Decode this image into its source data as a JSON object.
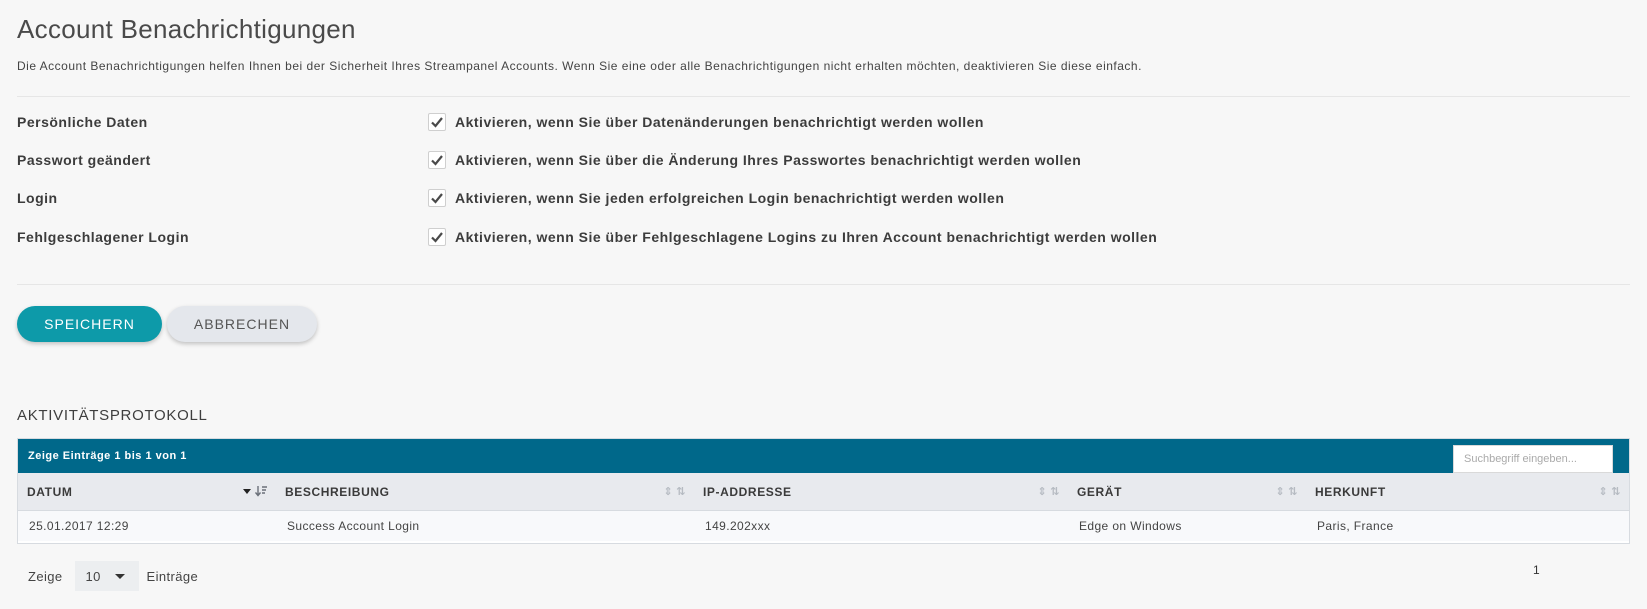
{
  "header": {
    "title": "Account Benachrichtigungen",
    "description": "Die Account Benachrichtigungen helfen Ihnen bei der Sicherheit Ihres Streampanel Accounts. Wenn Sie eine oder alle Benachrichtigungen nicht erhalten möchten, deaktivieren Sie diese einfach."
  },
  "settings": [
    {
      "label": "Persönliche Daten",
      "text": "Aktivieren, wenn Sie über Datenänderungen benachrichtigt werden wollen",
      "checked": true
    },
    {
      "label": "Passwort geändert",
      "text": "Aktivieren, wenn Sie über die Änderung Ihres Passwortes benachrichtigt werden wollen",
      "checked": true
    },
    {
      "label": "Login",
      "text": "Aktivieren, wenn Sie jeden erfolgreichen Login benachrichtigt werden wollen",
      "checked": true
    },
    {
      "label": "Fehlgeschlagener Login",
      "text": "Aktivieren, wenn Sie über Fehlgeschlagene Logins zu Ihren Account benachrichtigt werden wollen",
      "checked": true
    }
  ],
  "buttons": {
    "save": "SPEICHERN",
    "cancel": "ABBRECHEN"
  },
  "activity": {
    "title": "AKTIVITÄTSPROTOKOLL",
    "info": "Zeige Einträge 1 bis 1 von 1",
    "search_placeholder": "Suchbegriff eingeben...",
    "columns": [
      "DATUM",
      "BESCHREIBUNG",
      "IP-ADDRESSE",
      "GERÄT",
      "HERKUNFT"
    ],
    "rows": [
      [
        "25.01.2017 12:29",
        "Success Account Login",
        "149.202xxx",
        "Edge on Windows",
        "Paris, France"
      ]
    ],
    "length_prefix": "Zeige",
    "length_value": "10",
    "length_suffix": "Einträge",
    "current_page": "1"
  },
  "colors": {
    "accent": "#0d9aa9",
    "table_header": "#00688a",
    "cancel_bg": "#e4e7ec"
  }
}
